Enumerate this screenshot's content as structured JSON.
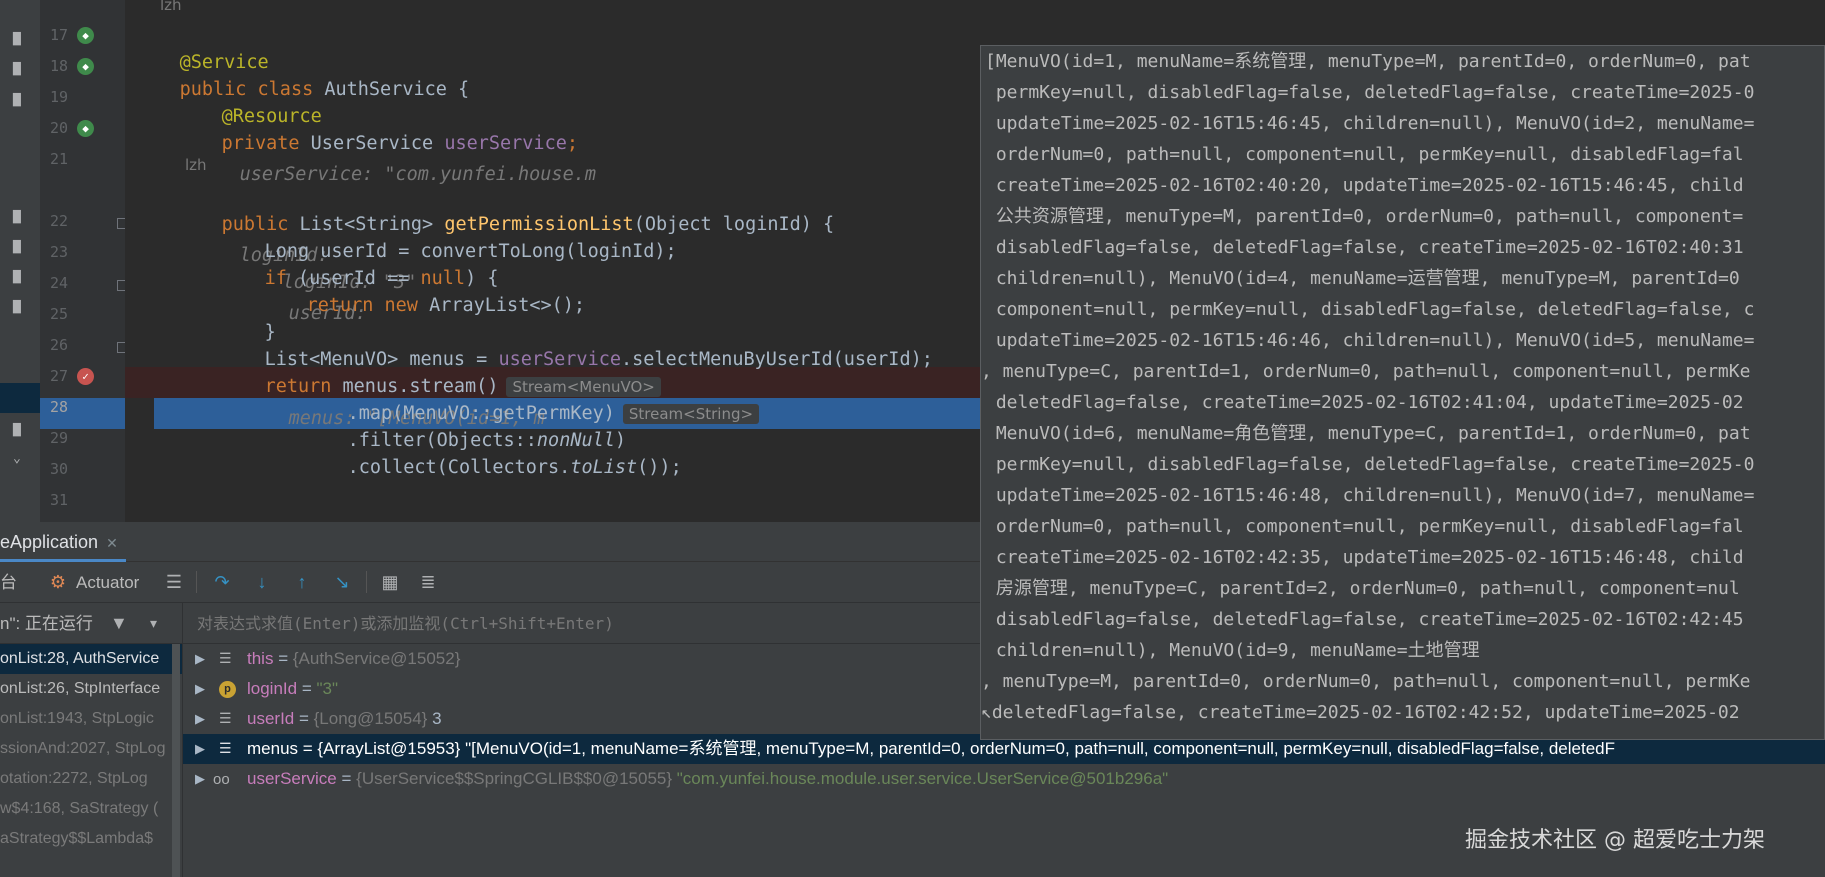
{
  "editor": {
    "author_label": "lzh",
    "lines": [
      {
        "num": "17"
      },
      {
        "num": "18"
      },
      {
        "num": "19"
      },
      {
        "num": "20"
      },
      {
        "num": "21"
      },
      {
        "num": "22"
      },
      {
        "num": "23"
      },
      {
        "num": "24"
      },
      {
        "num": "25"
      },
      {
        "num": "26"
      },
      {
        "num": "27"
      },
      {
        "num": "28"
      },
      {
        "num": "29"
      },
      {
        "num": "30"
      },
      {
        "num": "31"
      }
    ],
    "code": {
      "l17": "@Service",
      "l18a": "public class ",
      "l18b": "AuthService {",
      "l19": "@Resource",
      "l20a": "private ",
      "l20b": "UserService ",
      "l20c": "userService",
      "l20d": ";",
      "l20hint": "userService: \"com.yunfei.house.m",
      "l22a": "public ",
      "l22b": "List<String> ",
      "l22c": "getPermissionList",
      "l22d": "(Object loginId) {",
      "l22hint": "loginId:",
      "l23a": "Long userId = convertToLong(loginId);",
      "l23hint1": "loginId: \"3\"",
      "l23hint2": "userId:",
      "l24a": "if ",
      "l24b": "(userId == ",
      "l24c": "null",
      "l24d": ") {",
      "l25a": "return new ",
      "l25b": "ArrayList<>();",
      "l26": "}",
      "l27a": "List<MenuVO> menus = ",
      "l27b": "userService",
      "l27c": ".selectMenuByUserId(userId);",
      "l28a": "return ",
      "l28b": "menus.stream()",
      "l28chip": "Stream<MenuVO>",
      "l28hint": "menus: \"[MenuVO(id=1, m",
      "l29a": ".map(MenuVO::getPermKey)",
      "l29chip": "Stream<String>",
      "l30a": ".filter(Objects::",
      "l30b": "nonNull",
      "l30c": ")",
      "l31a": ".collect(Collectors.",
      "l31b": "toList",
      "l31c": "());"
    }
  },
  "tooltip": {
    "lines": [
      "[MenuVO(id=1, menuName=系统管理, menuType=M, parentId=0, orderNum=0, pat",
      " permKey=null, disabledFlag=false, deletedFlag=false, createTime=2025-0",
      " updateTime=2025-02-16T15:46:45, children=null), MenuVO(id=2, menuName=",
      " orderNum=0, path=null, component=null, permKey=null, disabledFlag=fal",
      " createTime=2025-02-16T02:40:20, updateTime=2025-02-16T15:46:45, child",
      " 公共资源管理, menuType=M, parentId=0, orderNum=0, path=null, component=",
      " disabledFlag=false, deletedFlag=false, createTime=2025-02-16T02:40:31",
      " children=null), MenuVO(id=4, menuName=运营管理, menuType=M, parentId=0",
      " component=null, permKey=null, disabledFlag=false, deletedFlag=false, c",
      " updateTime=2025-02-16T15:46:46, children=null), MenuVO(id=5, menuName=",
      ", menuType=C, parentId=1, orderNum=0, path=null, component=null, permKe",
      " deletedFlag=false, createTime=2025-02-16T02:41:04, updateTime=2025-02",
      " MenuVO(id=6, menuName=角色管理, menuType=C, parentId=1, orderNum=0, pat",
      " permKey=null, disabledFlag=false, deletedFlag=false, createTime=2025-0",
      " updateTime=2025-02-16T15:46:48, children=null), MenuVO(id=7, menuName=",
      " orderNum=0, path=null, component=null, permKey=null, disabledFlag=fal",
      " createTime=2025-02-16T02:42:35, updateTime=2025-02-16T15:46:48, child",
      " 房源管理, menuType=C, parentId=2, orderNum=0, path=null, component=nul",
      " disabledFlag=false, deletedFlag=false, createTime=2025-02-16T02:42:45",
      " children=null), MenuVO(id=9, menuName=土地管理",
      ", menuType=M, parentId=0, orderNum=0, path=null, component=null, permKe",
      "↖deletedFlag=false, createTime=2025-02-16T02:42:52, updateTime=2025-02"
    ]
  },
  "debug": {
    "run_tab": "eApplication",
    "toolbar": {
      "console_label": "台",
      "actuator_label": "Actuator"
    },
    "thread_status": "n\": 正在运行",
    "eval_placeholder": "对表达式求值(Enter)或添加监视(Ctrl+Shift+Enter)",
    "frames": [
      "onList:28, AuthService",
      "onList:26, StpInterface",
      "onList:1943, StpLogic",
      "ssionAnd:2027, StpLog",
      "otation:2272, StpLog",
      "w$4:168, SaStrategy (",
      "aStrategy$$Lambda$"
    ],
    "variables": [
      {
        "name": "this",
        "eq": " = ",
        "type": "{AuthService@15052}",
        "value": ""
      },
      {
        "name": "loginId",
        "eq": " = ",
        "type": "",
        "value": "\"3\""
      },
      {
        "name": "userId",
        "eq": " = ",
        "type": "{Long@15054}",
        "value": " 3"
      },
      {
        "name": "menus",
        "eq": " = ",
        "type": "{ArrayList@15953}",
        "value": " \"[MenuVO(id=1, menuName=系统管理, menuType=M, parentId=0, orderNum=0, path=null, component=null, permKey=null, disabledFlag=false, deletedF"
      },
      {
        "name": "userService",
        "eq": " = ",
        "type": "{UserService$$SpringCGLIB$$0@15055}",
        "value": " \"com.yunfei.house.module.user.service.UserService@501b296a\""
      }
    ]
  },
  "watermark": "掘金技术社区 @ 超爱吃士力架",
  "colors": {
    "keyword": "#cc7832",
    "annotation": "#bbb529",
    "method": "#ffc66d",
    "field": "#9876aa",
    "exec_line": "#2d5f99",
    "breakpoint_line": "#3a2323"
  }
}
